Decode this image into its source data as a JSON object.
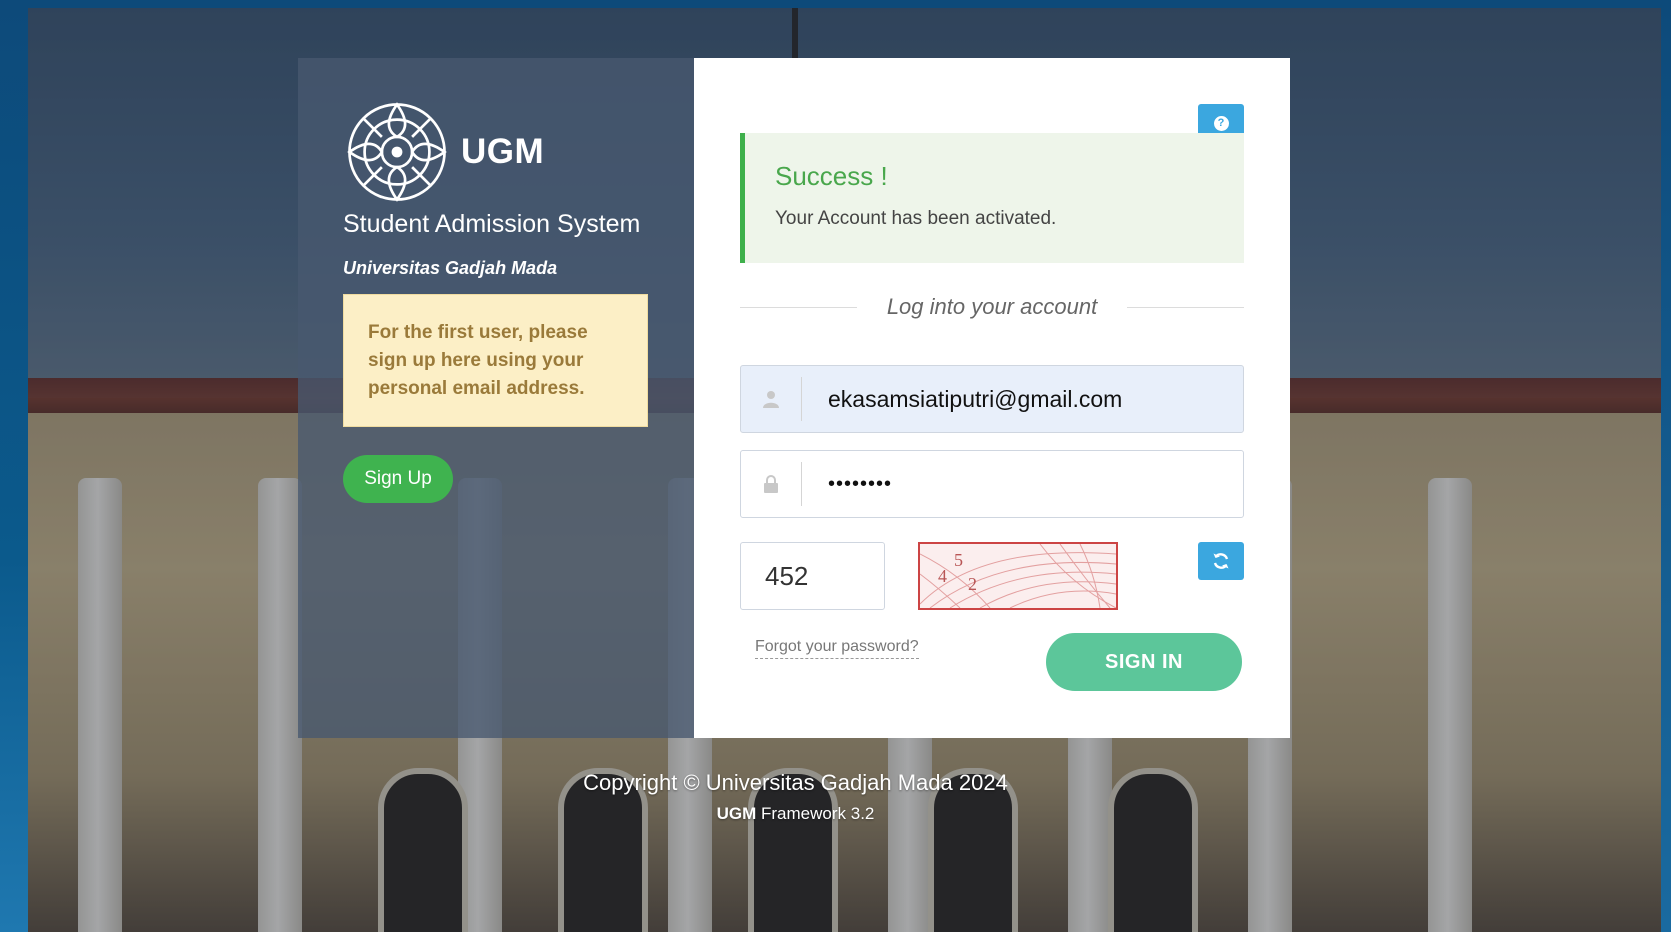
{
  "brand": {
    "name": "UGM",
    "system_title": "Student Admission System",
    "university": "Universitas Gadjah Mada"
  },
  "notice": {
    "text": "For the first user, please sign up here using your personal email address."
  },
  "signup": {
    "label": "Sign Up"
  },
  "alert": {
    "title": "Success !",
    "message": "Your Account has been activated."
  },
  "login": {
    "heading": "Log into your account",
    "email_value": "ekasamsiatiputri@gmail.com",
    "password_value": "••••••••",
    "captcha_value": "452",
    "captcha_image_digits": [
      "4",
      "5",
      "2"
    ],
    "forgot_label": "Forgot your password?",
    "signin_label": "SIGN IN"
  },
  "icons": {
    "help": "help-icon",
    "user": "user-icon",
    "lock": "lock-icon",
    "refresh": "refresh-icon",
    "logo": "ugm-logo"
  },
  "colors": {
    "success": "#49a74c",
    "info_button": "#3ba7df",
    "signin_button": "#5cc69a",
    "signup_button": "#3fb34f",
    "notice_bg": "#fcefc6"
  },
  "footer": {
    "copyright": "Copyright © Universitas Gadjah Mada 2024",
    "framework_brand": "UGM",
    "framework_text": "Framework 3.2"
  }
}
